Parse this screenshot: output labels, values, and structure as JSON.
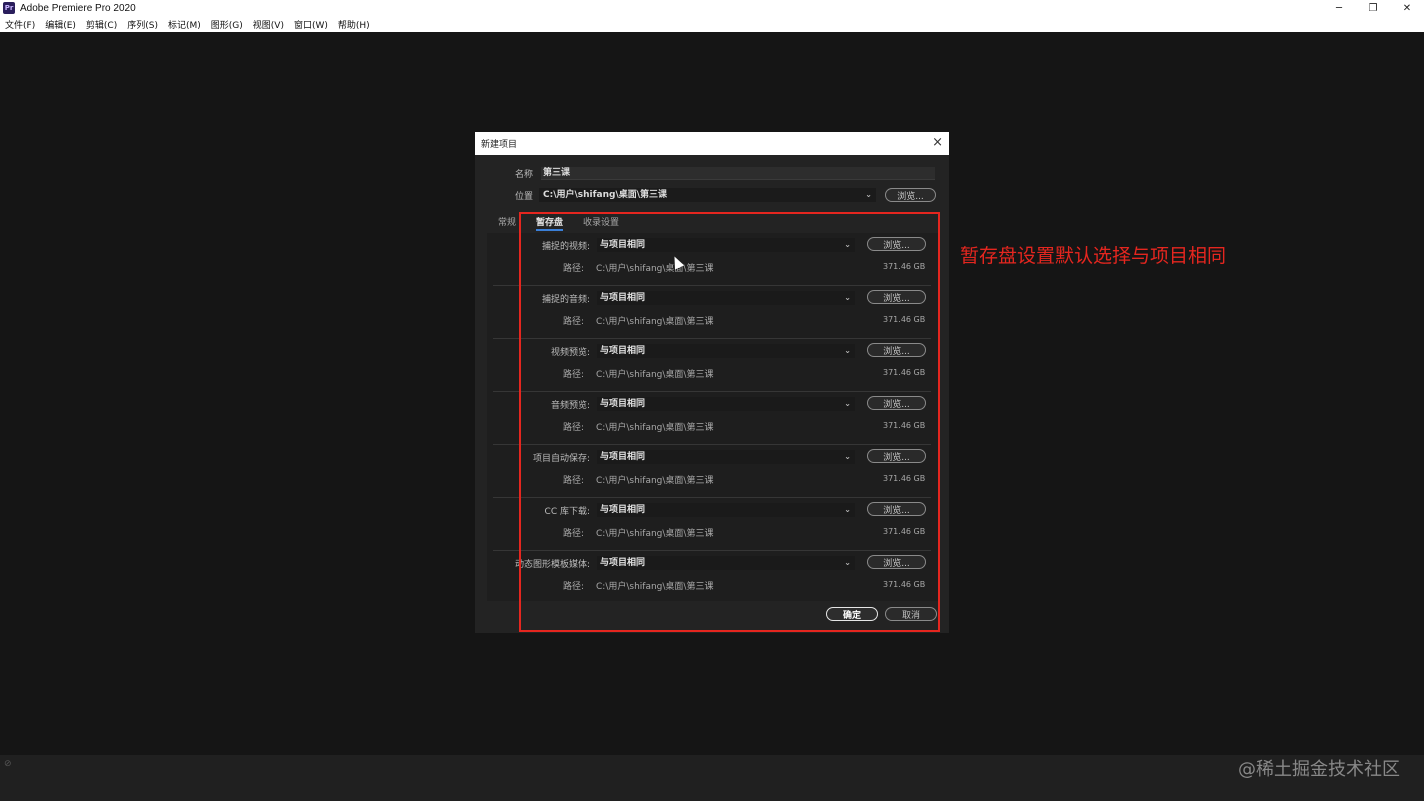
{
  "window": {
    "icon_text": "Pr",
    "title": "Adobe Premiere Pro 2020",
    "minimize": "─",
    "restore": "❐",
    "close": "✕"
  },
  "menu": [
    "文件(F)",
    "编辑(E)",
    "剪辑(C)",
    "序列(S)",
    "标记(M)",
    "图形(G)",
    "视图(V)",
    "窗口(W)",
    "帮助(H)"
  ],
  "dialog": {
    "title": "新建项目",
    "close": "×",
    "name_label": "名称",
    "name_value": "第三课",
    "location_label": "位置",
    "location_value": "C:\\用户\\shifang\\桌面\\第三课",
    "browse": "浏览...",
    "tabs": [
      "常规",
      "暂存盘",
      "收录设置"
    ],
    "active_tab": "暂存盘",
    "path_label": "路径:",
    "scratch_disks": [
      {
        "label": "捕捉的视频:",
        "value": "与项目相同",
        "path": "C:\\用户\\shifang\\桌面\\第三课",
        "size": "371.46 GB"
      },
      {
        "label": "捕捉的音频:",
        "value": "与项目相同",
        "path": "C:\\用户\\shifang\\桌面\\第三课",
        "size": "371.46 GB"
      },
      {
        "label": "视频预览:",
        "value": "与项目相同",
        "path": "C:\\用户\\shifang\\桌面\\第三课",
        "size": "371.46 GB"
      },
      {
        "label": "音频预览:",
        "value": "与项目相同",
        "path": "C:\\用户\\shifang\\桌面\\第三课",
        "size": "371.46 GB"
      },
      {
        "label": "项目自动保存:",
        "value": "与项目相同",
        "path": "C:\\用户\\shifang\\桌面\\第三课",
        "size": "371.46 GB"
      },
      {
        "label": "CC 库下载:",
        "value": "与项目相同",
        "path": "C:\\用户\\shifang\\桌面\\第三课",
        "size": "371.46 GB"
      },
      {
        "label": "动态图形模板媒体:",
        "value": "与项目相同",
        "path": "C:\\用户\\shifang\\桌面\\第三课",
        "size": "371.46 GB"
      }
    ],
    "ok": "确定",
    "cancel": "取消"
  },
  "annotation": {
    "text": "暂存盘设置默认选择与项目相同",
    "color": "#e5261f"
  },
  "watermark": "@稀土掘金技术社区"
}
